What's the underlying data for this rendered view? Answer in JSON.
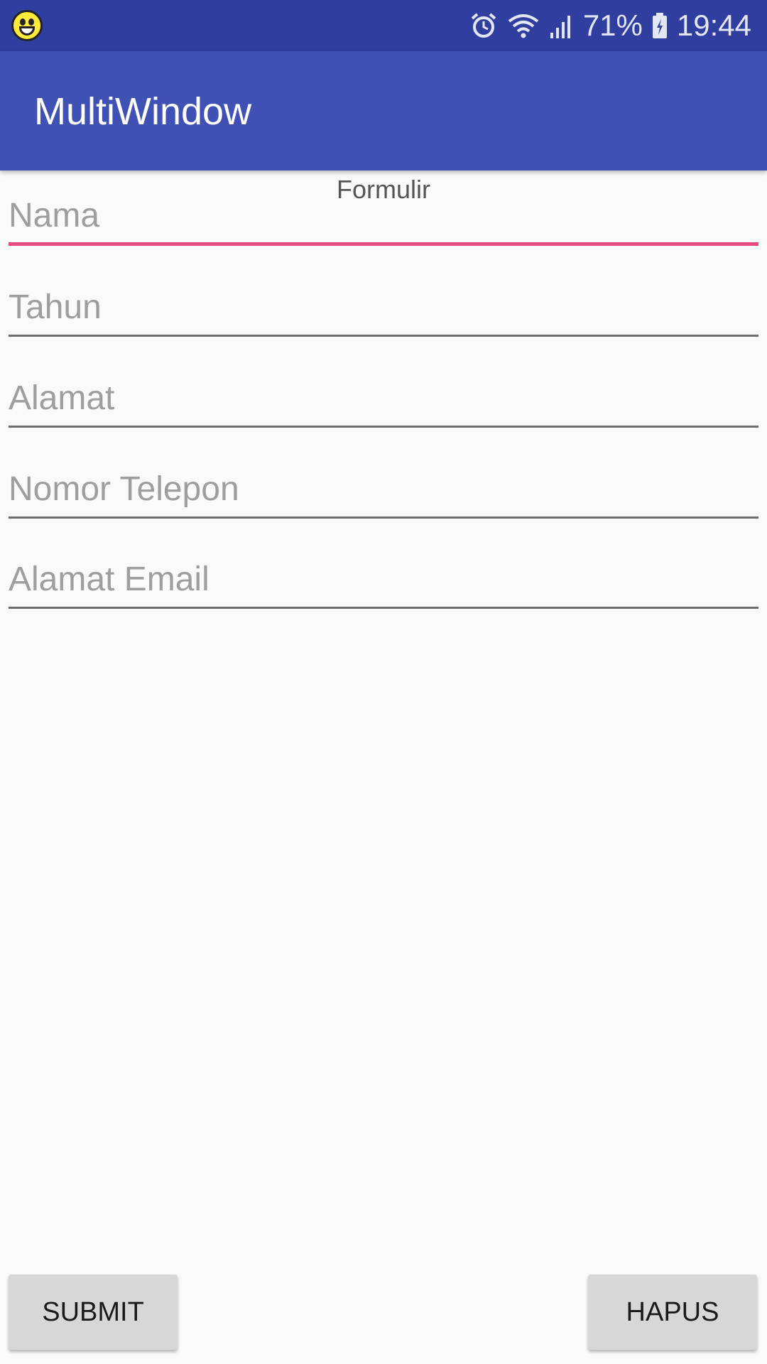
{
  "status_bar": {
    "battery": "71%",
    "time": "19:44",
    "icons": [
      "emoji-notification-icon",
      "alarm-icon",
      "wifi-icon",
      "signal-icon",
      "battery-icon"
    ]
  },
  "app_bar": {
    "title": "MultiWindow"
  },
  "form": {
    "heading": "Formulir",
    "fields": [
      {
        "placeholder": "Nama",
        "value": ""
      },
      {
        "placeholder": "Tahun",
        "value": ""
      },
      {
        "placeholder": "Alamat",
        "value": ""
      },
      {
        "placeholder": "Nomor Telepon",
        "value": ""
      },
      {
        "placeholder": "Alamat Email",
        "value": ""
      }
    ]
  },
  "buttons": {
    "submit": "SUBMIT",
    "hapus": "HAPUS"
  },
  "colors": {
    "status_bar": "#303f9f",
    "app_bar": "#3f51b5",
    "accent": "#e8497c",
    "background": "#fafafa"
  }
}
